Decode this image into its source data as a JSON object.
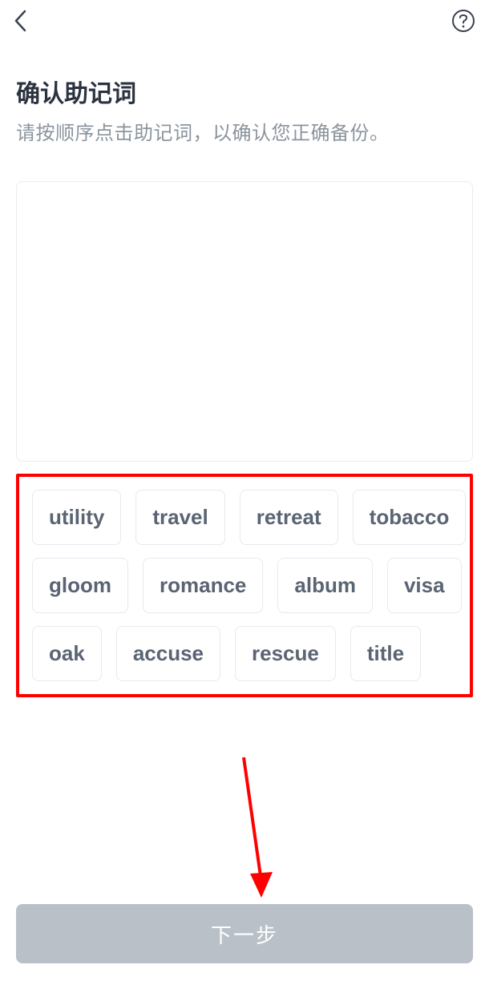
{
  "header": {
    "back_icon": "back-icon",
    "help_icon": "help-icon"
  },
  "page": {
    "title": "确认助记词",
    "subtitle": "请按顺序点击助记词，以确认您正确备份。"
  },
  "words": [
    "utility",
    "travel",
    "retreat",
    "tobacco",
    "gloom",
    "romance",
    "album",
    "visa",
    "oak",
    "accuse",
    "rescue",
    "title"
  ],
  "footer": {
    "next_button": "下一步"
  },
  "annotation": {
    "highlight_color": "#ff0000",
    "arrow_color": "#ff0000"
  }
}
